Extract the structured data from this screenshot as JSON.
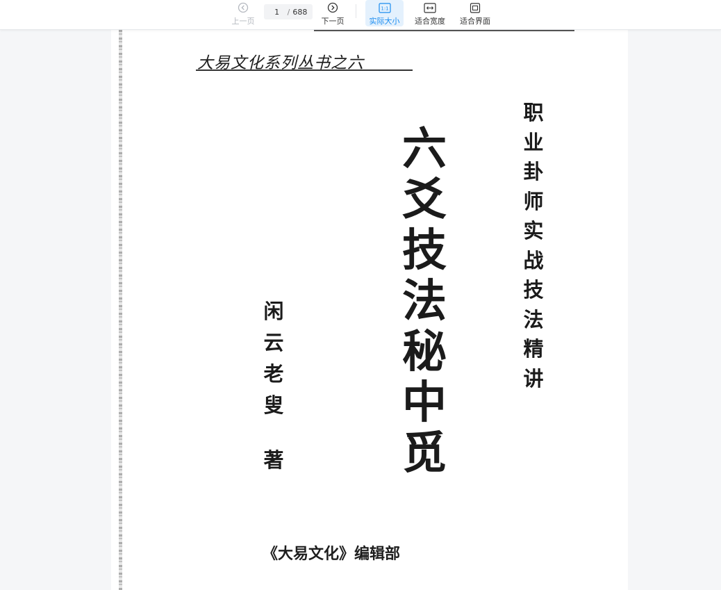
{
  "toolbar": {
    "prev_label": "上一页",
    "next_label": "下一页",
    "current_page": "1",
    "page_separator": "/",
    "total_pages": "688",
    "actual_size_label": "实际大小",
    "actual_size_glyph": "1:1",
    "fit_width_label": "适合宽度",
    "fit_page_label": "适合界面",
    "active_mode": "actual_size",
    "accent_color": "#1a8cf0",
    "icons": {
      "prev": "chevron-left-circle-icon",
      "next": "chevron-right-circle-icon",
      "actual_size": "actual-size-icon",
      "fit_width": "fit-width-icon",
      "fit_page": "fit-page-icon"
    }
  },
  "document": {
    "series": "大易文化系列丛书之六",
    "subtitle_chars": [
      "职",
      "业",
      "卦",
      "师",
      "实",
      "战",
      "技",
      "法",
      "精",
      "讲"
    ],
    "title_chars": [
      "六",
      "爻",
      "技",
      "法",
      "秘",
      "中",
      "觅"
    ],
    "author_chars": [
      "闲",
      "云",
      "老",
      "叟"
    ],
    "author_role": "著",
    "publisher": "《大易文化》编辑部"
  }
}
